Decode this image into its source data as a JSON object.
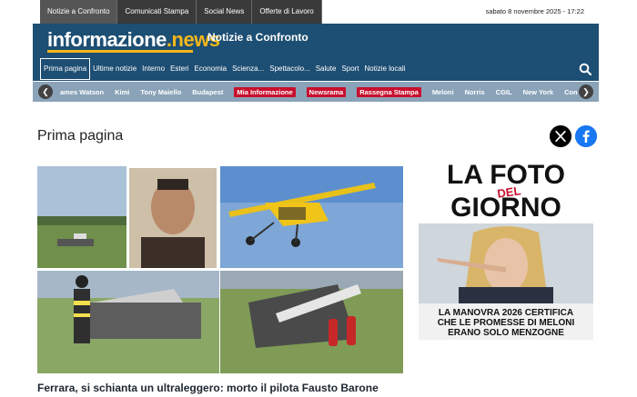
{
  "top_tabs": [
    {
      "label": "Notizie a Confronto"
    },
    {
      "label": "Comunicati Stampa"
    },
    {
      "label": "Social News"
    },
    {
      "label": "Offerte di Lavoro"
    }
  ],
  "datetime": "sabato 8 novembre 2025 - 17:22",
  "header": {
    "logo_main": "informazione",
    "logo_suffix": ".news",
    "tagline": "Notizie a Confronto"
  },
  "nav": [
    {
      "label": "Prima pagina"
    },
    {
      "label": "Ultime notizie"
    },
    {
      "label": "Interno"
    },
    {
      "label": "Esteri"
    },
    {
      "label": "Economia"
    },
    {
      "label": "Scienza..."
    },
    {
      "label": "Spettacolo..."
    },
    {
      "label": "Salute"
    },
    {
      "label": "Sport"
    },
    {
      "label": "Notizie locali"
    }
  ],
  "tags": [
    {
      "label": "ames Watson"
    },
    {
      "label": "Kimi"
    },
    {
      "label": "Tony Maiello"
    },
    {
      "label": "Budapest"
    },
    {
      "label": "Mia Informazione"
    },
    {
      "label": "Newsrama"
    },
    {
      "label": "Rassegna Stampa"
    },
    {
      "label": "Meloni"
    },
    {
      "label": "Norris"
    },
    {
      "label": "CGIL"
    },
    {
      "label": "New York"
    },
    {
      "label": "Como Ca"
    }
  ],
  "section_title": "Prima pagina",
  "headline": "Ferrara, si schianta un ultraleggero: morto il pilota Fausto Barone",
  "foto": {
    "title_line1": "LA FOTO",
    "title_del": "DEL",
    "title_line2": "GIORNO",
    "caption_line1": "LA MANOVRA 2026 CERTIFICA",
    "caption_line2": "CHE LE PROMESSE DI MELONI",
    "caption_line3": "ERANO SOLO MENZOGNE"
  },
  "colors": {
    "header_bg": "#1d4e73",
    "accent_yellow": "#f5b71a",
    "tagbar_bg": "#8aa3b9",
    "tag_highlight": "#c8102e"
  }
}
